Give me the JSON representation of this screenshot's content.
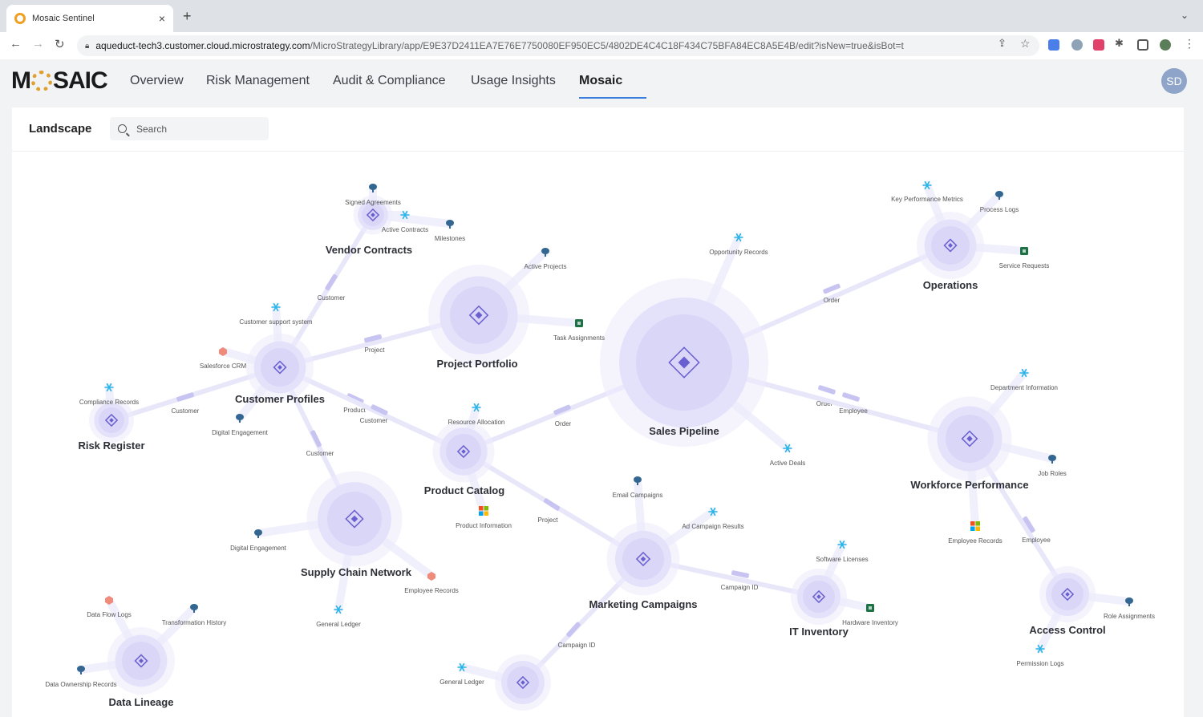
{
  "browser": {
    "tab_title": "Mosaic Sentinel",
    "tab_close": "×",
    "new_tab": "+",
    "url_host": "aqueduct-tech3.customer.cloud.microstrategy.com",
    "url_path": "/MicroStrategyLibrary/app/E9E37D2411EA7E76E7750080EF950EC5/4802DE4C4C18F434C75BFA84EC8A5E4B/edit?isNew=true&isBot=t"
  },
  "app": {
    "logo_left": "M",
    "logo_right": "SAIC",
    "nav": [
      "Overview",
      "Risk Management",
      "Audit & Compliance",
      "Usage Insights",
      "Mosaic"
    ],
    "active_nav": "Mosaic",
    "avatar": "SD"
  },
  "landscape": {
    "title": "Landscape",
    "search_placeholder": "Search"
  },
  "colors": {
    "node_halo": "#ecebfb",
    "node_core": "#d9d6f7",
    "node_icon": "#6a5fd0",
    "edge": "#e8e7fa",
    "edge_marker": "#c8c4f2",
    "snowflake": "#29b5e8",
    "postgres": "#336791",
    "excel": "#1e7145",
    "salesforce": "#f08a7a"
  },
  "nodes": [
    {
      "name": "Vendor Contracts"
    },
    {
      "name": "Project Portfolio"
    },
    {
      "name": "Sales Pipeline"
    },
    {
      "name": "Operations"
    },
    {
      "name": "Customer Profiles"
    },
    {
      "name": "Risk Register"
    },
    {
      "name": "Product Catalog"
    },
    {
      "name": "Workforce Performance"
    },
    {
      "name": "Supply Chain Network"
    },
    {
      "name": "Marketing Campaigns"
    },
    {
      "name": "IT Inventory"
    },
    {
      "name": "Access Control"
    },
    {
      "name": "Data Lineage"
    },
    {
      "name": ""
    }
  ],
  "sources": [
    {
      "label": "Signed Agreements",
      "icon": "postgres-icon"
    },
    {
      "label": "Active Contracts",
      "icon": "snowflake-icon"
    },
    {
      "label": "Milestones",
      "icon": "postgres-icon"
    },
    {
      "label": "Active Projects",
      "icon": "postgres-icon"
    },
    {
      "label": "Task Assignments",
      "icon": "excel-icon"
    },
    {
      "label": "Opportunity Records",
      "icon": "snowflake-icon"
    },
    {
      "label": "Key Performance Metrics",
      "icon": "snowflake-icon"
    },
    {
      "label": "Process Logs",
      "icon": "postgres-icon"
    },
    {
      "label": "Service Requests",
      "icon": "excel-icon"
    },
    {
      "label": "Customer support system",
      "icon": "snowflake-icon"
    },
    {
      "label": "Salesforce CRM",
      "icon": "salesforce-icon"
    },
    {
      "label": "Compliance Records",
      "icon": "snowflake-icon"
    },
    {
      "label": "Digital Engagement",
      "icon": "postgres-icon"
    },
    {
      "label": "Resource Allocation",
      "icon": "snowflake-icon"
    },
    {
      "label": "Department Information",
      "icon": "snowflake-icon"
    },
    {
      "label": "Active Deals",
      "icon": "snowflake-icon"
    },
    {
      "label": "Job Roles",
      "icon": "postgres-icon"
    },
    {
      "label": "Email Campaigns",
      "icon": "postgres-icon"
    },
    {
      "label": "Ad Campaign Results",
      "icon": "snowflake-icon"
    },
    {
      "label": "Product Information",
      "icon": "microsoft-icon"
    },
    {
      "label": "Digital Engagement",
      "icon": "postgres-icon"
    },
    {
      "label": "Employee Records",
      "icon": "salesforce-icon"
    },
    {
      "label": "General Ledger",
      "icon": "snowflake-icon"
    },
    {
      "label": "Software Licenses",
      "icon": "snowflake-icon"
    },
    {
      "label": "Hardware Inventory",
      "icon": "excel-icon"
    },
    {
      "label": "Employee Records",
      "icon": "microsoft-icon"
    },
    {
      "label": "Role Assignments",
      "icon": "postgres-icon"
    },
    {
      "label": "Permission Logs",
      "icon": "snowflake-icon"
    },
    {
      "label": "Data Flow Logs",
      "icon": "salesforce-icon"
    },
    {
      "label": "Transformation History",
      "icon": "postgres-icon"
    },
    {
      "label": "Data Ownership Records",
      "icon": "postgres-icon"
    },
    {
      "label": "General Ledger",
      "icon": "snowflake-icon"
    }
  ],
  "edges": [
    {
      "from": "Vendor Contracts",
      "to": "Customer Profiles",
      "label": "Customer"
    },
    {
      "from": "Customer Profiles",
      "to": "Project Portfolio",
      "label": "Project"
    },
    {
      "from": "Customer Profiles",
      "to": "Risk Register",
      "label": "Customer"
    },
    {
      "from": "Customer Profiles",
      "to": "Product Catalog",
      "label": "Product"
    },
    {
      "from": "Customer Profiles",
      "to": "Product Catalog",
      "label": "Customer"
    },
    {
      "from": "Customer Profiles",
      "to": "Supply Chain Network",
      "label": "Customer"
    },
    {
      "from": "Product Catalog",
      "to": "Sales Pipeline",
      "label": "Order"
    },
    {
      "from": "Sales Pipeline",
      "to": "Operations",
      "label": "Order"
    },
    {
      "from": "Sales Pipeline",
      "to": "Workforce Performance",
      "label": "Order"
    },
    {
      "from": "Sales Pipeline",
      "to": "Workforce Performance",
      "label": "Employee"
    },
    {
      "from": "Product Catalog",
      "to": "Marketing Campaigns",
      "label": "Project"
    },
    {
      "from": "Marketing Campaigns",
      "to": "IT Inventory",
      "label": "Campaign ID"
    },
    {
      "from": "Marketing Campaigns",
      "to": "",
      "label": "Campaign ID"
    },
    {
      "from": "Workforce Performance",
      "to": "Access Control",
      "label": "Employee"
    }
  ]
}
